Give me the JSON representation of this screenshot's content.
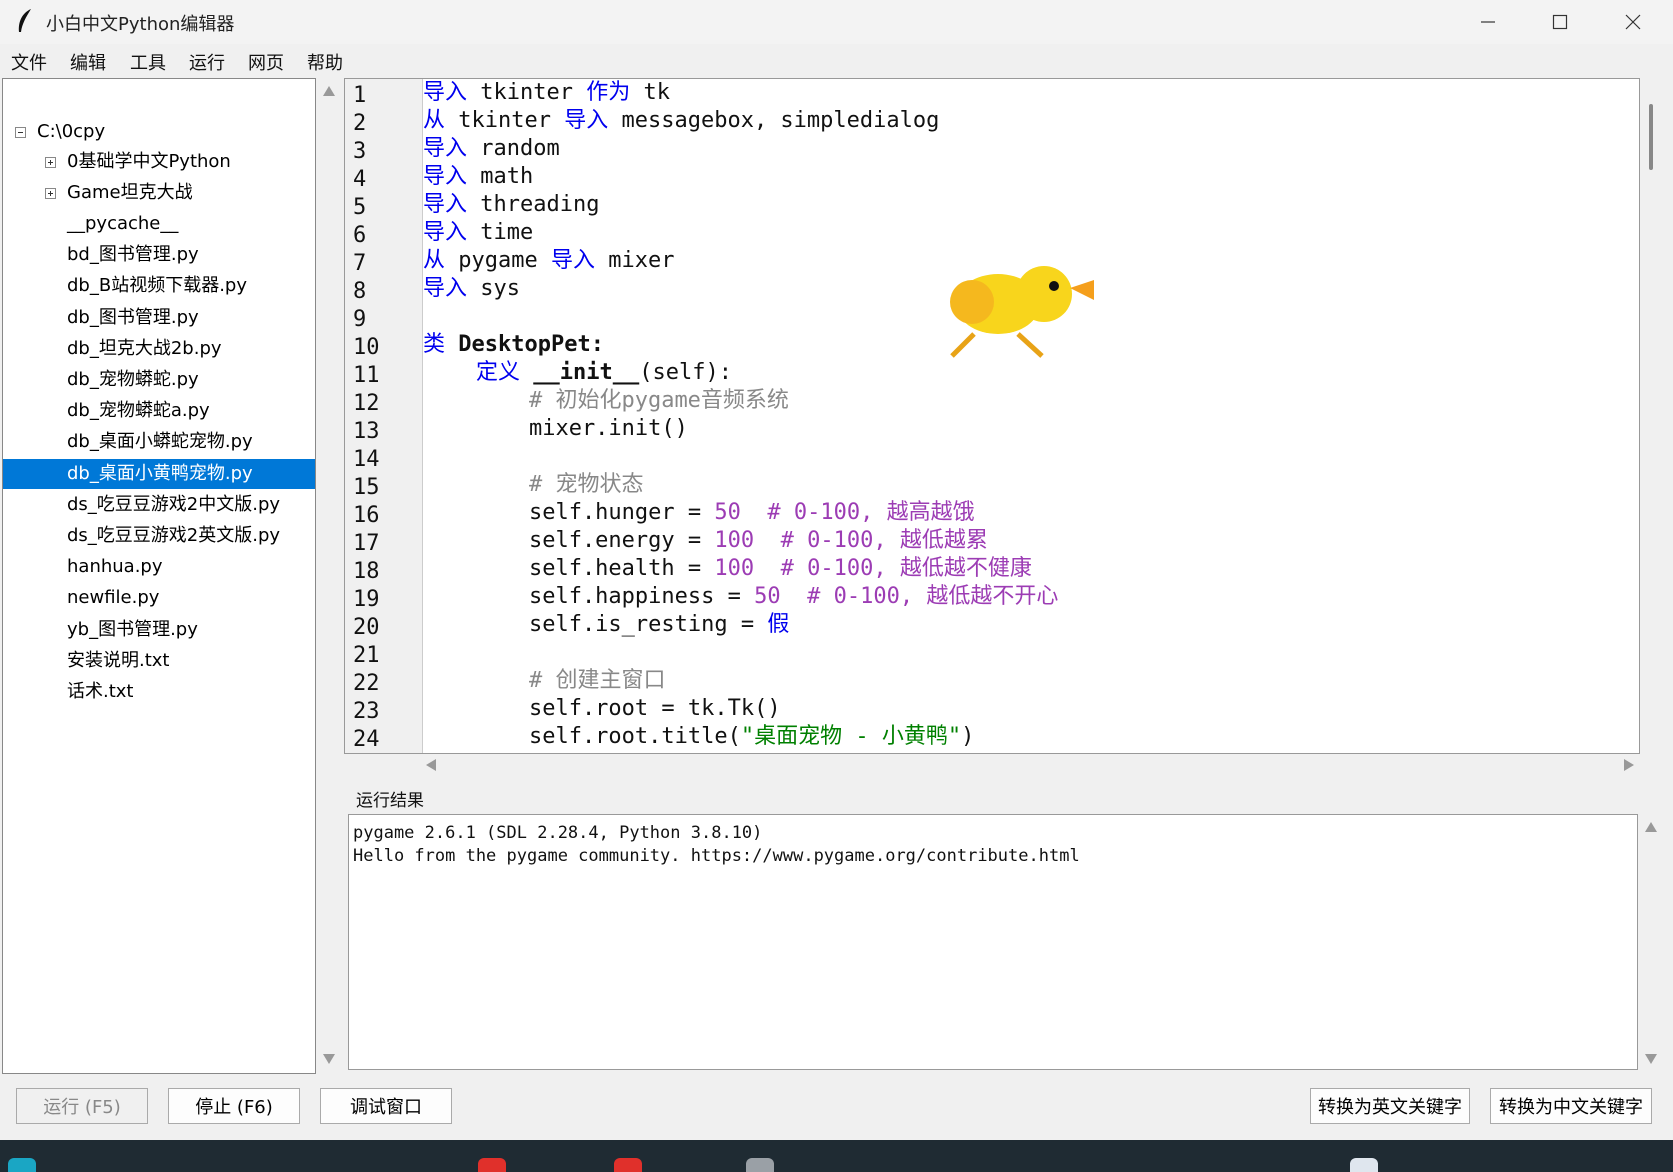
{
  "window": {
    "title": "小白中文Python编辑器"
  },
  "menu": [
    "文件",
    "编辑",
    "工具",
    "运行",
    "网页",
    "帮助"
  ],
  "tree": {
    "root": "C:\\0cpy",
    "folders": [
      "0基础学中文Python",
      "Game坦克大战"
    ],
    "files": [
      "__pycache__",
      "bd_图书管理.py",
      "db_B站视频下载器.py",
      "db_图书管理.py",
      "db_坦克大战2b.py",
      "db_宠物蟒蛇.py",
      "db_宠物蟒蛇a.py",
      "db_桌面小蟒蛇宠物.py",
      "db_桌面小黄鸭宠物.py",
      "ds_吃豆豆游戏2中文版.py",
      "ds_吃豆豆游戏2英文版.py",
      "hanhua.py",
      "newfile.py",
      "yb_图书管理.py",
      "安装说明.txt",
      "话术.txt"
    ],
    "selected_index": 8
  },
  "editor": {
    "line_numbers": [
      "1",
      "2",
      "3",
      "4",
      "5",
      "6",
      "7",
      "8",
      "9",
      "10",
      "11",
      "12",
      "13",
      "14",
      "15",
      "16",
      "17",
      "18",
      "19",
      "20",
      "21",
      "22",
      "23",
      "24"
    ],
    "lines": [
      [
        {
          "t": "导入",
          "c": "kw"
        },
        {
          "t": " tkinter "
        },
        {
          "t": "作为",
          "c": "kw"
        },
        {
          "t": " tk"
        }
      ],
      [
        {
          "t": "从",
          "c": "kw"
        },
        {
          "t": " tkinter "
        },
        {
          "t": "导入",
          "c": "kw"
        },
        {
          "t": " messagebox, simpledialog"
        }
      ],
      [
        {
          "t": "导入",
          "c": "kw"
        },
        {
          "t": " random"
        }
      ],
      [
        {
          "t": "导入",
          "c": "kw"
        },
        {
          "t": " math"
        }
      ],
      [
        {
          "t": "导入",
          "c": "kw"
        },
        {
          "t": " threading"
        }
      ],
      [
        {
          "t": "导入",
          "c": "kw"
        },
        {
          "t": " time"
        }
      ],
      [
        {
          "t": "从",
          "c": "kw"
        },
        {
          "t": " pygame "
        },
        {
          "t": "导入",
          "c": "kw"
        },
        {
          "t": " mixer"
        }
      ],
      [
        {
          "t": "导入",
          "c": "kw"
        },
        {
          "t": " sys"
        }
      ],
      [],
      [
        {
          "t": "类",
          "c": "kw"
        },
        {
          "t": " DesktopPet:",
          "c": "b"
        }
      ],
      [
        {
          "t": "    "
        },
        {
          "t": "定义",
          "c": "kw"
        },
        {
          "t": " "
        },
        {
          "t": "__init__",
          "c": "b"
        },
        {
          "t": "(self):"
        }
      ],
      [
        {
          "t": "        "
        },
        {
          "t": "# 初始化pygame音频系统",
          "c": "cm"
        }
      ],
      [
        {
          "t": "        mixer.init()"
        }
      ],
      [],
      [
        {
          "t": "        "
        },
        {
          "t": "# 宠物状态",
          "c": "cm"
        }
      ],
      [
        {
          "t": "        self.hunger = "
        },
        {
          "t": "50",
          "c": "num"
        },
        {
          "t": "  "
        },
        {
          "t": "# 0-100, 越高越饿",
          "c": "num"
        }
      ],
      [
        {
          "t": "        self.energy = "
        },
        {
          "t": "100",
          "c": "num"
        },
        {
          "t": "  "
        },
        {
          "t": "# 0-100, 越低越累",
          "c": "num"
        }
      ],
      [
        {
          "t": "        self.health = "
        },
        {
          "t": "100",
          "c": "num"
        },
        {
          "t": "  "
        },
        {
          "t": "# 0-100, 越低越不健康",
          "c": "num"
        }
      ],
      [
        {
          "t": "        self.happiness = "
        },
        {
          "t": "50",
          "c": "num"
        },
        {
          "t": "  "
        },
        {
          "t": "# 0-100, 越低越不开心",
          "c": "num"
        }
      ],
      [
        {
          "t": "        self.is_resting = "
        },
        {
          "t": "假",
          "c": "kw"
        }
      ],
      [],
      [
        {
          "t": "        "
        },
        {
          "t": "# 创建主窗口",
          "c": "cm"
        }
      ],
      [
        {
          "t": "        self.root = tk.Tk()"
        }
      ],
      [
        {
          "t": "        self.root.title("
        },
        {
          "t": "\"桌面宠物 - 小黄鸭\"",
          "c": "str"
        },
        {
          "t": ")"
        }
      ]
    ]
  },
  "output": {
    "label": "运行结果",
    "lines": [
      "pygame 2.6.1 (SDL 2.28.4, Python 3.8.10)",
      "Hello from the pygame community. https://www.pygame.org/contribute.html"
    ]
  },
  "buttons": {
    "run": "运行 (F5)",
    "stop": "停止 (F6)",
    "debug": "调试窗口",
    "to_english": "转换为英文关键字",
    "to_chinese": "转换为中文关键字"
  },
  "colors": {
    "selection": "#0078d7",
    "keyword": "#0000ee",
    "number": "#9c3cb4",
    "comment": "#888888",
    "string": "#008000",
    "duck": "#f8d51c"
  }
}
